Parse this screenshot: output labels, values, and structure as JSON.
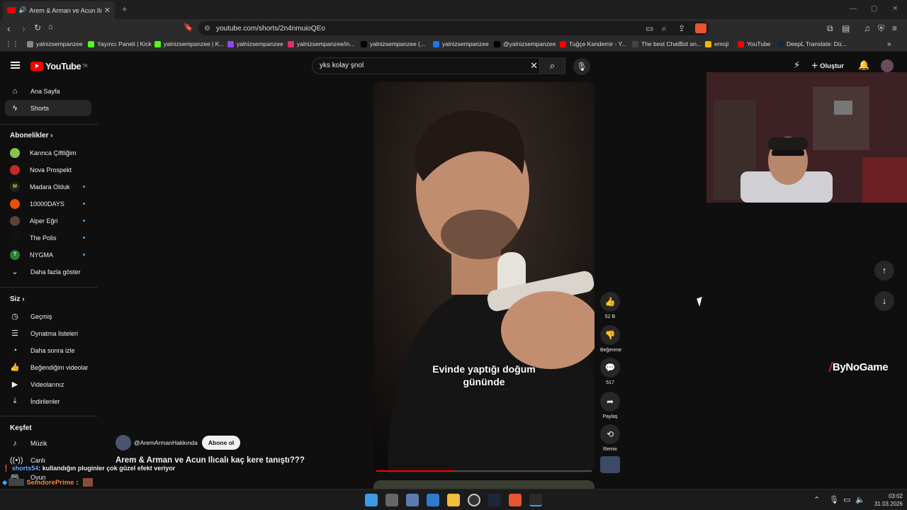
{
  "browser": {
    "tab_title": "Arem & Arman ve Acun Ilıcalı",
    "url": "youtube.com/shorts/2n4nmuioQEo",
    "bookmarks": [
      {
        "label": "yalnizsempanzee",
        "color": "#888"
      },
      {
        "label": "Yayıncı Paneli | Kick",
        "color": "#53fc18"
      },
      {
        "label": "yalnizsempanzee | K...",
        "color": "#53fc18"
      },
      {
        "label": "yalnizsempanzee",
        "color": "#9146ff"
      },
      {
        "label": "yalnizsempanzee/in...",
        "color": "#e1306c"
      },
      {
        "label": "yalnizsempanzee (...",
        "color": "#000"
      },
      {
        "label": "yalnizsempanzee",
        "color": "#1877f2"
      },
      {
        "label": "@yalnizsempanzee",
        "color": "#000"
      },
      {
        "label": "Tuğçe Kandemir - Y...",
        "color": "#f00"
      },
      {
        "label": "The best ChatBot an...",
        "color": "#444"
      },
      {
        "label": "emoji",
        "color": "#f5b400"
      },
      {
        "label": "YouTube",
        "color": "#f00"
      },
      {
        "label": "DeepL Translate: Dü...",
        "color": "#0f2b46"
      }
    ]
  },
  "yt": {
    "logo": "YouTube",
    "region": "TR",
    "search_value": "yks kolay şnol",
    "create_label": "Oluştur"
  },
  "sidebar": {
    "home": "Ana Sayfa",
    "shorts": "Shorts",
    "subs_header": "Abonelikler",
    "subs": [
      {
        "name": "Karınca Çiftliğim",
        "color": "#8bc34a",
        "glyph": "",
        "dot": false
      },
      {
        "name": "Nova Prospekt",
        "color": "#c62828",
        "glyph": "",
        "dot": false
      },
      {
        "name": "Madara Olduk",
        "color": "#222",
        "glyph": "M",
        "dot": true
      },
      {
        "name": "10000DAYS",
        "color": "#e65100",
        "glyph": "",
        "dot": true
      },
      {
        "name": "Alper Eğri",
        "color": "#5d4037",
        "glyph": "",
        "dot": true
      },
      {
        "name": "The Polis",
        "color": "#111",
        "glyph": "",
        "dot": true
      },
      {
        "name": "NYGMA",
        "color": "#2e7d32",
        "glyph": "?",
        "dot": true
      }
    ],
    "show_more": "Daha fazla göster",
    "you_header": "Siz",
    "you": [
      "Geçmiş",
      "Oynatma listeleri",
      "Daha sonra izle",
      "Beğendiğim videolar",
      "Videolarınız",
      "İndirilenler"
    ],
    "explore_header": "Keşfet",
    "explore": [
      "Müzik",
      "Canlı",
      "Oyun"
    ]
  },
  "video": {
    "caption_line1": "Evinde yaptığı doğum",
    "caption_line2": "gününde",
    "progress": 0.36,
    "channel": "@AremArmanHakkında",
    "subscribe": "Abone ol",
    "title": "Arem & Arman ve Acun Ilıcalı kaç kere tanıştı???"
  },
  "actions": {
    "likes": "52 B",
    "dislike": "Beğenme",
    "comments": "517",
    "share": "Paylaş",
    "remix": "Remix"
  },
  "chat": {
    "user1": "shorts54",
    "msg1": ": kullandığın pluginler çok güzel efekt veriyor",
    "user2": "SemdorePrime",
    "msg2": ":"
  },
  "brand": {
    "a": "By",
    "b": "NoGame"
  },
  "clock": {
    "time": "03:02",
    "date": "31.03.2026"
  }
}
